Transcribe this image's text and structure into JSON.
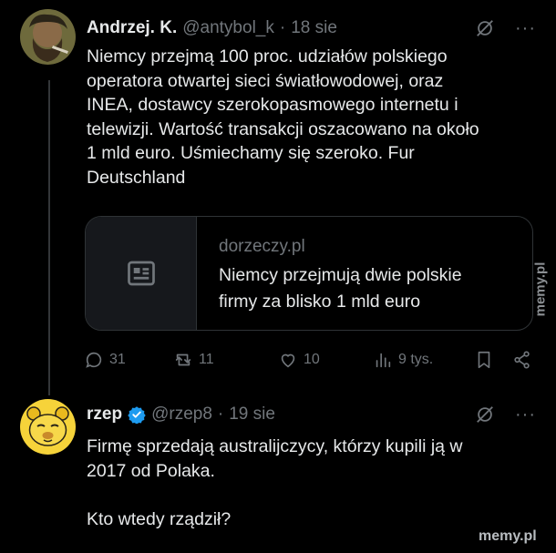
{
  "tweet1": {
    "author_name": "Andrzej. K.",
    "handle": "@antybol_k",
    "separator": "·",
    "date": "18 sie",
    "more_label": "···",
    "text": "Niemcy przejmą 100 proc. udziałów polskiego\noperatora otwartej sieci światłowodowej, oraz\nINEA, dostawcy szerokopasmowego internetu i\ntelewizji. Wartość transakcji oszacowano na około\n1 mld euro. Uśmiechamy się szeroko. Fur\nDeutschland",
    "card": {
      "domain": "dorzeczy.pl",
      "title": "Niemcy przejmują dwie polskie\nfirmy za blisko 1 mld euro"
    },
    "stats": {
      "replies": "31",
      "reposts": "11",
      "likes": "10",
      "views": "9 tys."
    }
  },
  "tweet2": {
    "author_name": "rzep",
    "handle": "@rzep8",
    "separator": "·",
    "date": "19 sie",
    "more_label": "···",
    "text": "Firmę sprzedają australijczycy, którzy kupili ją w\n2017 od Polaka.\n\nKto wtedy rządził?"
  },
  "watermarks": {
    "side": "memy.pl",
    "bottom": "memy.pl"
  },
  "colors": {
    "background": "#000000",
    "text": "#e7e9ea",
    "muted": "#71767b",
    "border": "#2f3336",
    "verified": "#1d9bf0"
  }
}
